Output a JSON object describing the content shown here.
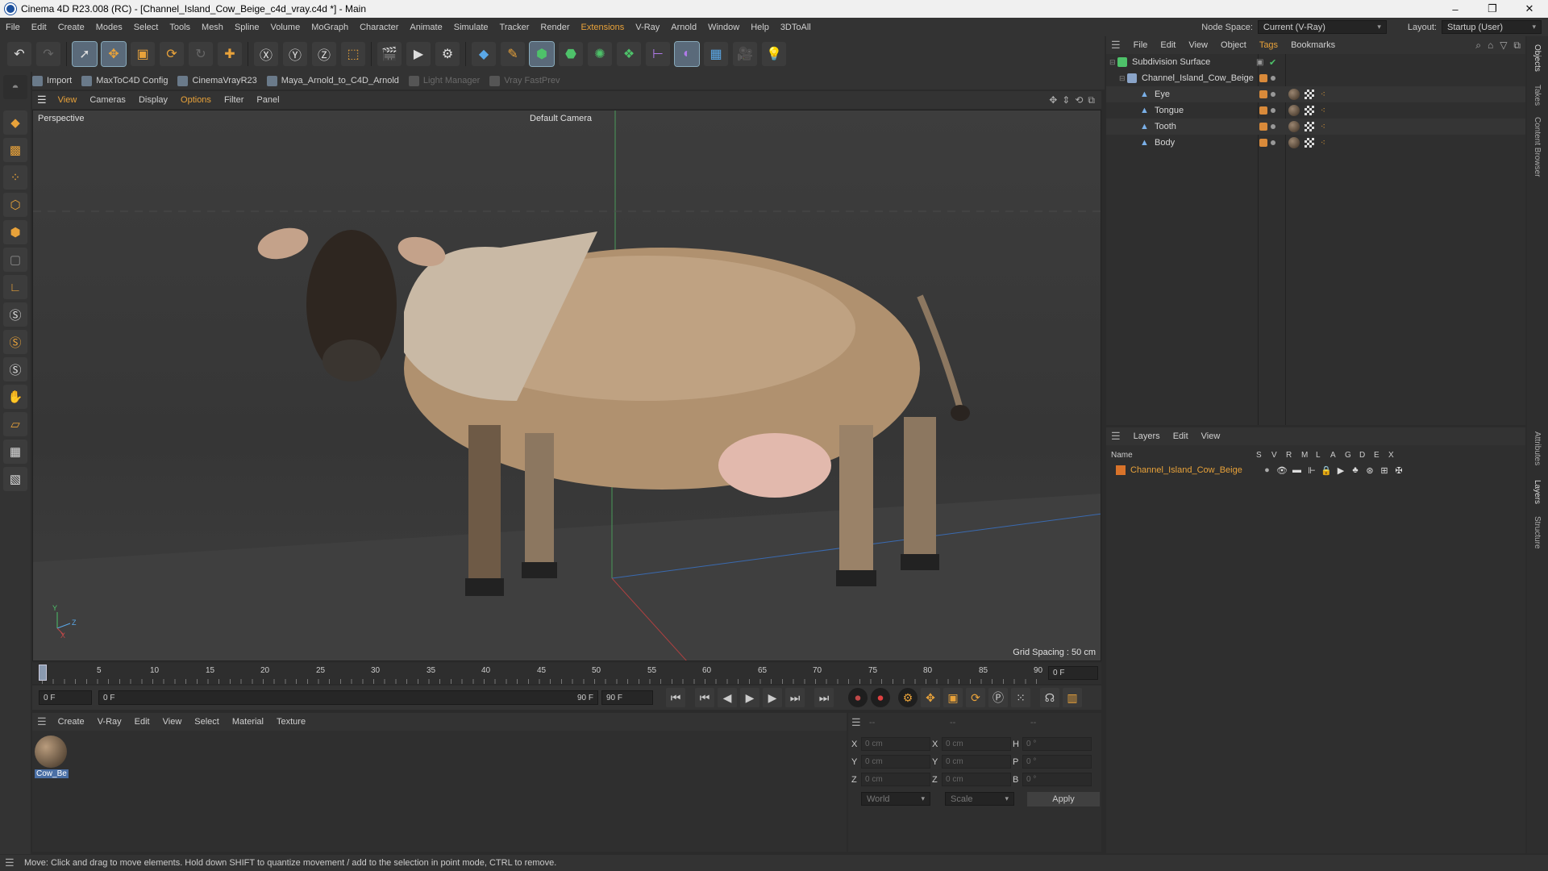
{
  "window": {
    "title": "Cinema 4D R23.008 (RC) - [Channel_Island_Cow_Beige_c4d_vray.c4d *] - Main",
    "controls": [
      "–",
      "❐",
      "✕"
    ]
  },
  "menubar": {
    "items": [
      "File",
      "Edit",
      "Create",
      "Modes",
      "Select",
      "Tools",
      "Mesh",
      "Spline",
      "Volume",
      "MoGraph",
      "Character",
      "Animate",
      "Simulate",
      "Tracker",
      "Render",
      "Extensions",
      "V-Ray",
      "Arnold",
      "Window",
      "Help",
      "3DToAll"
    ],
    "node_space_label": "Node Space:",
    "node_space_value": "Current (V-Ray)",
    "layout_label": "Layout:",
    "layout_value": "Startup (User)"
  },
  "pluginbar": {
    "items": [
      "Import",
      "MaxToC4D Config",
      "CinemaVrayR23",
      "Maya_Arnold_to_C4D_Arnold",
      "Light Manager",
      "Vray FastPrev"
    ]
  },
  "viewport": {
    "menu": [
      "View",
      "Cameras",
      "Display",
      "Options",
      "Filter",
      "Panel"
    ],
    "label": "Perspective",
    "camera": "Default Camera",
    "grid_spacing": "Grid Spacing : 50 cm",
    "axis_y": "Y",
    "axis_z": "Z",
    "axis_x": "X"
  },
  "timeline": {
    "ticks": [
      "0",
      "5",
      "10",
      "15",
      "20",
      "25",
      "30",
      "35",
      "40",
      "45",
      "50",
      "55",
      "60",
      "65",
      "70",
      "75",
      "80",
      "85",
      "90"
    ],
    "current_frame": "0 F"
  },
  "transport": {
    "start": "0 F",
    "range_start": "0 F",
    "range_end": "90 F",
    "end": "90 F"
  },
  "materials": {
    "menu": [
      "Create",
      "V-Ray",
      "Edit",
      "View",
      "Select",
      "Material",
      "Texture"
    ],
    "items": [
      {
        "name": "Cow_Be"
      }
    ]
  },
  "coordinates": {
    "header": [
      "--",
      "--",
      "--"
    ],
    "rows": [
      {
        "a": "X",
        "av": "0 cm",
        "b": "X",
        "bv": "0 cm",
        "c": "H",
        "cv": "0 °"
      },
      {
        "a": "Y",
        "av": "0 cm",
        "b": "Y",
        "bv": "0 cm",
        "c": "P",
        "cv": "0 °"
      },
      {
        "a": "Z",
        "av": "0 cm",
        "b": "Z",
        "bv": "0 cm",
        "c": "B",
        "cv": "0 °"
      }
    ],
    "mode1": "World",
    "mode2": "Scale",
    "apply": "Apply"
  },
  "objects": {
    "menu": [
      "File",
      "Edit",
      "View",
      "Object",
      "Tags",
      "Bookmarks"
    ],
    "items": [
      {
        "name": "Subdivision Surface"
      },
      {
        "name": "Channel_Island_Cow_Beige"
      },
      {
        "name": "Eye"
      },
      {
        "name": "Tongue"
      },
      {
        "name": "Tooth"
      },
      {
        "name": "Body"
      }
    ]
  },
  "layers": {
    "menu": [
      "Layers",
      "Edit",
      "View"
    ],
    "columns": [
      "Name",
      "S",
      "V",
      "R",
      "M",
      "L",
      "A",
      "G",
      "D",
      "E",
      "X"
    ],
    "items": [
      {
        "name": "Channel_Island_Cow_Beige"
      }
    ]
  },
  "sidetabs": [
    "Objects",
    "Takes",
    "Content Browser",
    "Attributes",
    "Layers",
    "Structure"
  ],
  "status": "Move: Click and drag to move elements. Hold down SHIFT to quantize movement / add to the selection in point mode, CTRL to remove.",
  "colors": {
    "accent": "#e8a23a",
    "layer_color": "#d9732a",
    "background": "#2b2b2b"
  }
}
